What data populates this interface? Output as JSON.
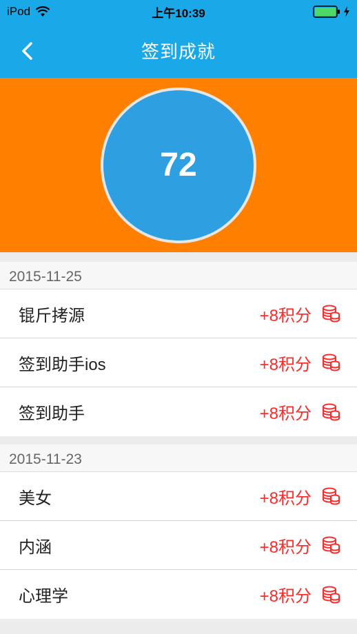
{
  "status_bar": {
    "carrier": "iPod",
    "time": "上午10:39"
  },
  "nav": {
    "title": "签到成就"
  },
  "score": {
    "value": "72"
  },
  "sections": [
    {
      "date": "2015-11-25",
      "items": [
        {
          "name": "锟斤拷源",
          "points": "+8积分"
        },
        {
          "name": "签到助手ios",
          "points": "+8积分"
        },
        {
          "name": "签到助手",
          "points": "+8积分"
        }
      ]
    },
    {
      "date": "2015-11-23",
      "items": [
        {
          "name": "美女",
          "points": "+8积分"
        },
        {
          "name": "内涵",
          "points": "+8积分"
        },
        {
          "name": "心理学",
          "points": "+8积分"
        }
      ]
    }
  ],
  "colors": {
    "nav_bg": "#1aa9e8",
    "hero_bg": "#ff8000",
    "circle_bg": "#2e9fe0",
    "points_text": "#ff2a2a"
  },
  "icons": {
    "back": "chevron-left-icon",
    "points": "coin-stack-icon",
    "wifi": "wifi-icon",
    "battery": "battery-icon",
    "charging": "charging-bolt-icon"
  }
}
